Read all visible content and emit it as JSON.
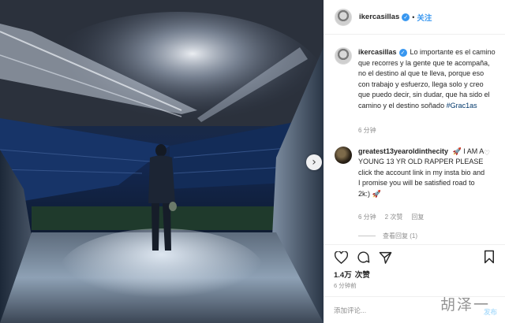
{
  "header": {
    "username": "ikercasillas",
    "separator": "•",
    "follow_label": "关注"
  },
  "caption": {
    "username": "ikercasillas",
    "text": "Lo importante es el camino que recorres y la gente que te acompaña, no el destino al que te lleva, porque eso con trabajo y esfuerzo, llega solo y creo que puedo decir, sin dudar, que ha sido el camino y el destino soñado",
    "hashtag": "#Grac1as",
    "time": "6 分钟"
  },
  "comment": {
    "username": "greatest13yearoldinthecity",
    "text": "🚀 I AM A YOUNG 13 YR OLD RAPPER PLEASE click the account link in my insta bio and I promise you will be satisfied road to 2k:) 🚀",
    "time": "6 分钟",
    "likes": "2 次赞",
    "reply_label": "回复",
    "view_replies": "查看回复 (1)"
  },
  "actions": {
    "likes_count": "1.4万",
    "likes_label": "次赞",
    "post_time": "6 分钟前"
  },
  "comment_box": {
    "placeholder": "添加评论...",
    "post_label": "发布"
  },
  "watermark": "胡泽一",
  "icons": {
    "verified": "verified-badge-icon",
    "heart": "heart-icon",
    "comment": "comment-icon",
    "share": "share-icon",
    "save": "bookmark-icon",
    "next": "chevron-right-icon"
  },
  "colors": {
    "accent": "#3897f0",
    "hashtag": "#00376b",
    "muted": "#8e8e8e"
  }
}
